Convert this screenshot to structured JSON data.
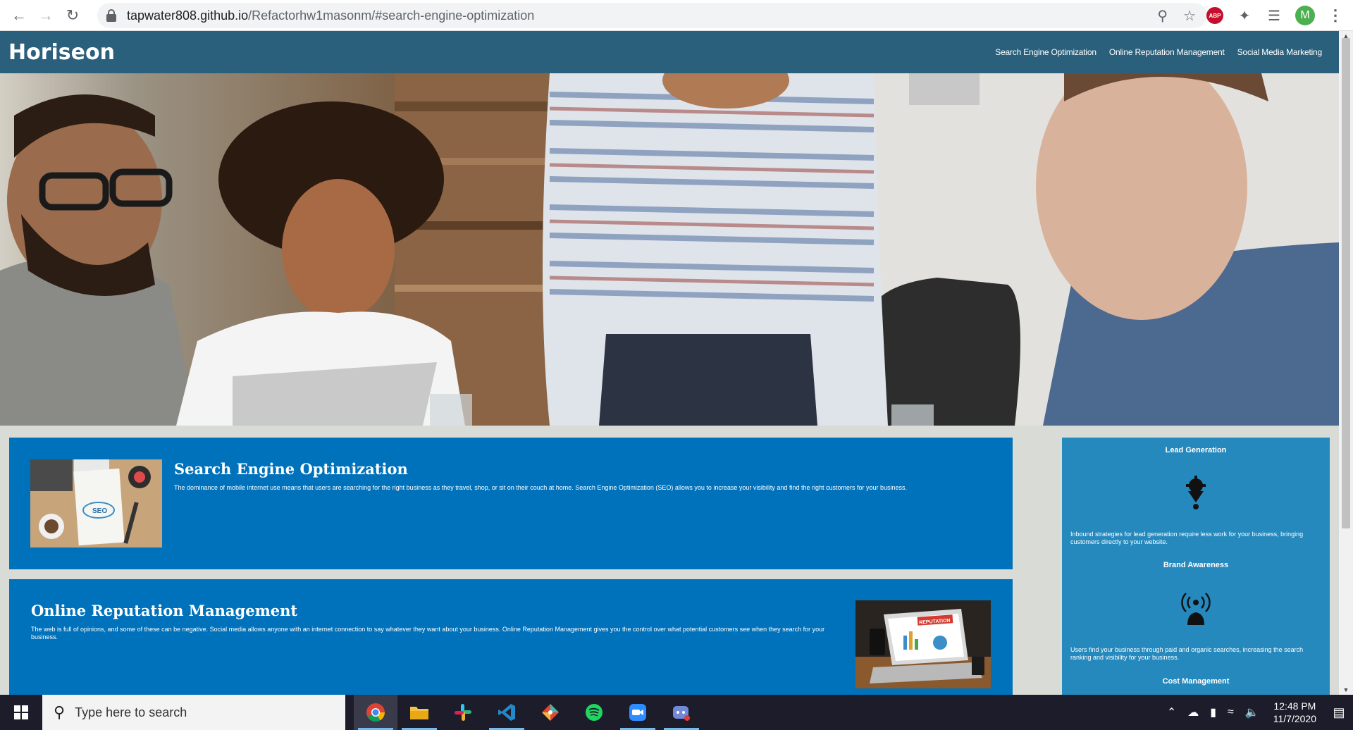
{
  "browser": {
    "url_host": "tapwater808.github.io",
    "url_path": "/Refactorhw1masonm/#search-engine-optimization",
    "profile_initial": "M",
    "abp_label": "ABP"
  },
  "site": {
    "logo": "Horiseon",
    "nav": [
      {
        "label": "Search Engine Optimization"
      },
      {
        "label": "Online Reputation Management"
      },
      {
        "label": "Social Media Marketing"
      }
    ]
  },
  "cards": {
    "seo": {
      "title": "Search Engine Optimization",
      "body": "The dominance of mobile internet use means that users are searching for the right business as they travel, shop, or sit on their couch at home. Search Engine Optimization (SEO) allows you to increase your visibility and find the right customers for your business.",
      "thumb_text": "SEO"
    },
    "orm": {
      "title": "Online Reputation Management",
      "body": "The web is full of opinions, and some of these can be negative. Social media allows anyone with an internet connection to say whatever they want about your business. Online Reputation Management gives you the control over what potential customers see when they search for your business.",
      "thumb_text": "REPUTATION"
    }
  },
  "sidebar": {
    "lead": {
      "title": "Lead Generation",
      "body": "Inbound strategies for lead generation require less work for your business, bringing customers directly to your website."
    },
    "brand": {
      "title": "Brand Awareness",
      "body": "Users find your business through paid and organic searches, increasing the search ranking and visibility for your business."
    },
    "cost": {
      "title": "Cost Management"
    }
  },
  "taskbar": {
    "search_placeholder": "Type here to search",
    "time": "12:48 PM",
    "date": "11/7/2020"
  },
  "colors": {
    "header": "#2a607c",
    "card": "#0072bb",
    "sidebar": "#2589bd",
    "page_bg": "#d9dcd6"
  }
}
